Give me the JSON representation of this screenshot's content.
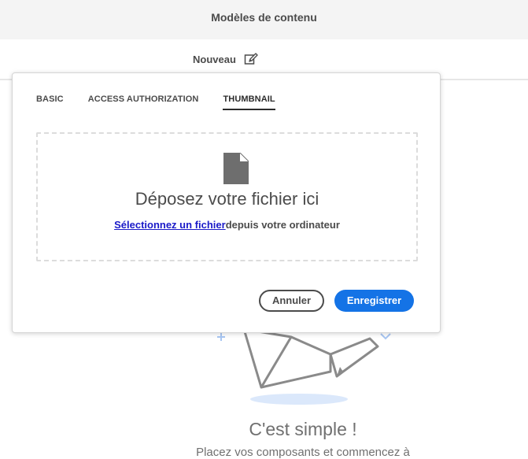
{
  "header": {
    "title": "Modèles de contenu"
  },
  "toolbar": {
    "new_label": "Nouveau",
    "new_icon": "edit-icon"
  },
  "dialog": {
    "tabs": [
      {
        "label": "BASIC",
        "active": false
      },
      {
        "label": "ACCESS AUTHORIZATION",
        "active": false
      },
      {
        "label": "THUMBNAIL",
        "active": true
      }
    ],
    "dropzone": {
      "icon": "file-icon",
      "title": "Déposez votre fichier ici",
      "link": "Sélectionnez un fichier",
      "suffix": "depuis votre ordinateur"
    },
    "buttons": {
      "cancel": "Annuler",
      "save": "Enregistrer"
    }
  },
  "empty_state": {
    "title": "C'est simple !",
    "subtitle": "Placez vos composants et commencez à"
  },
  "colors": {
    "accent": "#1473e6",
    "link": "#1a1ac8",
    "text": "#4b4b4b"
  }
}
